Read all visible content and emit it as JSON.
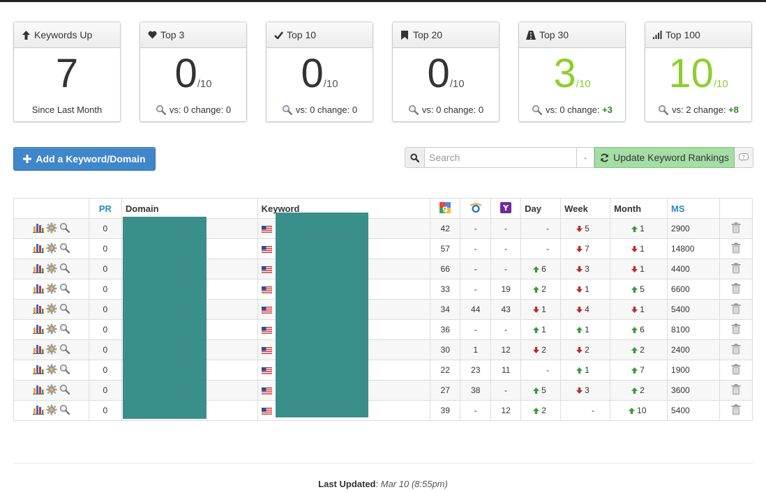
{
  "cards": [
    {
      "title": "Keywords Up",
      "icon": "arrow-up-icon",
      "value": "7",
      "denominator": "",
      "green": false,
      "footer_text": "Since Last Month",
      "vs": "",
      "change": ""
    },
    {
      "title": "Top 3",
      "icon": "heart-icon",
      "value": "0",
      "denominator": "/10",
      "green": false,
      "footer_text": "",
      "vs": "vs: 0 change: ",
      "change": "0"
    },
    {
      "title": "Top 10",
      "icon": "check-icon",
      "value": "0",
      "denominator": "/10",
      "green": false,
      "footer_text": "",
      "vs": "vs: 0 change: ",
      "change": "0"
    },
    {
      "title": "Top 20",
      "icon": "bookmark-icon",
      "value": "0",
      "denominator": "/10",
      "green": false,
      "footer_text": "",
      "vs": "vs: 0 change: ",
      "change": "0"
    },
    {
      "title": "Top 30",
      "icon": "road-icon",
      "value": "3",
      "denominator": "/10",
      "green": true,
      "footer_text": "",
      "vs": "vs: 0 change: ",
      "change": "+3"
    },
    {
      "title": "Top 100",
      "icon": "signal-icon",
      "value": "10",
      "denominator": "/10",
      "green": true,
      "footer_text": "",
      "vs": "vs: 2 change: ",
      "change": "+8"
    }
  ],
  "toolbar": {
    "add_label": "Add a Keyword/Domain",
    "search_placeholder": "Search",
    "dot_label": "·",
    "update_label": "Update Keyword Rankings"
  },
  "table": {
    "headers": {
      "pr": "PR",
      "domain": "Domain",
      "keyword": "Keyword",
      "day": "Day",
      "week": "Week",
      "month": "Month",
      "ms": "MS"
    },
    "rows": [
      {
        "pr": "0",
        "google": "42",
        "bing": "-",
        "yahoo": "-",
        "day": "-",
        "day_dir": "",
        "week": "5",
        "week_dir": "down",
        "month": "1",
        "month_dir": "up",
        "ms": "2900"
      },
      {
        "pr": "0",
        "google": "57",
        "bing": "-",
        "yahoo": "-",
        "day": "-",
        "day_dir": "",
        "week": "7",
        "week_dir": "down",
        "month": "1",
        "month_dir": "down",
        "ms": "14800"
      },
      {
        "pr": "0",
        "google": "66",
        "bing": "-",
        "yahoo": "-",
        "day": "6",
        "day_dir": "up",
        "week": "3",
        "week_dir": "down",
        "month": "1",
        "month_dir": "down",
        "ms": "4400"
      },
      {
        "pr": "0",
        "google": "33",
        "bing": "-",
        "yahoo": "19",
        "day": "2",
        "day_dir": "up",
        "week": "1",
        "week_dir": "down",
        "month": "5",
        "month_dir": "up",
        "ms": "6600"
      },
      {
        "pr": "0",
        "google": "34",
        "bing": "44",
        "yahoo": "43",
        "day": "1",
        "day_dir": "down",
        "week": "4",
        "week_dir": "down",
        "month": "1",
        "month_dir": "down",
        "ms": "5400"
      },
      {
        "pr": "0",
        "google": "36",
        "bing": "-",
        "yahoo": "-",
        "day": "1",
        "day_dir": "up",
        "week": "1",
        "week_dir": "up",
        "month": "6",
        "month_dir": "up",
        "ms": "8100"
      },
      {
        "pr": "0",
        "google": "30",
        "bing": "1",
        "yahoo": "12",
        "day": "2",
        "day_dir": "down",
        "week": "2",
        "week_dir": "down",
        "month": "2",
        "month_dir": "up",
        "ms": "2400"
      },
      {
        "pr": "0",
        "google": "22",
        "bing": "23",
        "yahoo": "11",
        "day": "-",
        "day_dir": "",
        "week": "1",
        "week_dir": "up",
        "month": "7",
        "month_dir": "up",
        "ms": "1900"
      },
      {
        "pr": "0",
        "google": "27",
        "bing": "38",
        "yahoo": "-",
        "day": "5",
        "day_dir": "up",
        "week": "3",
        "week_dir": "down",
        "month": "2",
        "month_dir": "up",
        "ms": "3600"
      },
      {
        "pr": "0",
        "google": "39",
        "bing": "-",
        "yahoo": "12",
        "day": "2",
        "day_dir": "up",
        "week": "-",
        "week_dir": "",
        "month": "10",
        "month_dir": "up",
        "ms": "5400"
      }
    ]
  },
  "footer": {
    "label": "Last Updated",
    "separator": ":",
    "value": "Mar 10 (8:55pm)"
  },
  "colors": {
    "accent_blue": "#3f86cb",
    "green_value": "#8ccf2d",
    "update_green": "#a5dea5",
    "redaction": "#3a8f8b",
    "arrow_up": "#3a9a3a",
    "arrow_down": "#c0282a"
  }
}
